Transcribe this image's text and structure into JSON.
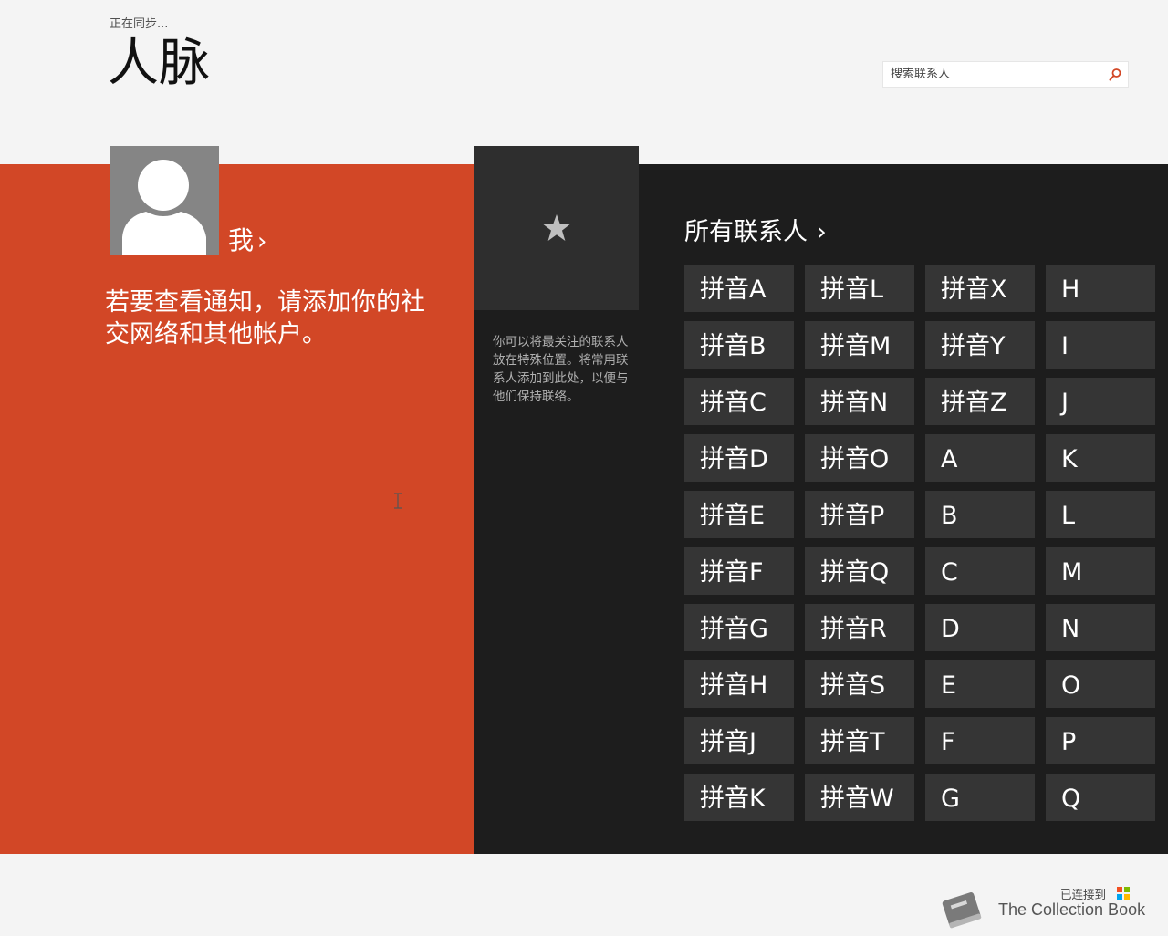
{
  "header": {
    "sync_status": "正在同步...",
    "title": "人脉",
    "search_placeholder": "搜索联系人"
  },
  "me": {
    "label": "我",
    "chevron": "›",
    "notification_text": "若要查看通知，请添加你的社交网络和其他帐户。"
  },
  "favorites": {
    "icon": "star-icon",
    "hint": "你可以将最关注的联系人放在特殊位置。将常用联系人添加到此处，以便与他们保持联络。"
  },
  "all_contacts": {
    "label": "所有联系人",
    "chevron": "›",
    "columns": [
      [
        "拼音A",
        "拼音B",
        "拼音C",
        "拼音D",
        "拼音E",
        "拼音F",
        "拼音G",
        "拼音H",
        "拼音J",
        "拼音K"
      ],
      [
        "拼音L",
        "拼音M",
        "拼音N",
        "拼音O",
        "拼音P",
        "拼音Q",
        "拼音R",
        "拼音S",
        "拼音T",
        "拼音W"
      ],
      [
        "拼音X",
        "拼音Y",
        "拼音Z",
        "A",
        "B",
        "C",
        "D",
        "E",
        "F",
        "G"
      ],
      [
        "H",
        "I",
        "J",
        "K",
        "L",
        "M",
        "N",
        "O",
        "P",
        "Q"
      ]
    ]
  },
  "footer": {
    "connected_label": "已连接到",
    "brand": "The Collection Book"
  },
  "colors": {
    "accent": "#d24726",
    "dark_panel": "#1d1d1d",
    "tile": "#353535",
    "favorites_tile": "#2e2e2e",
    "background": "#f4f4f4"
  }
}
